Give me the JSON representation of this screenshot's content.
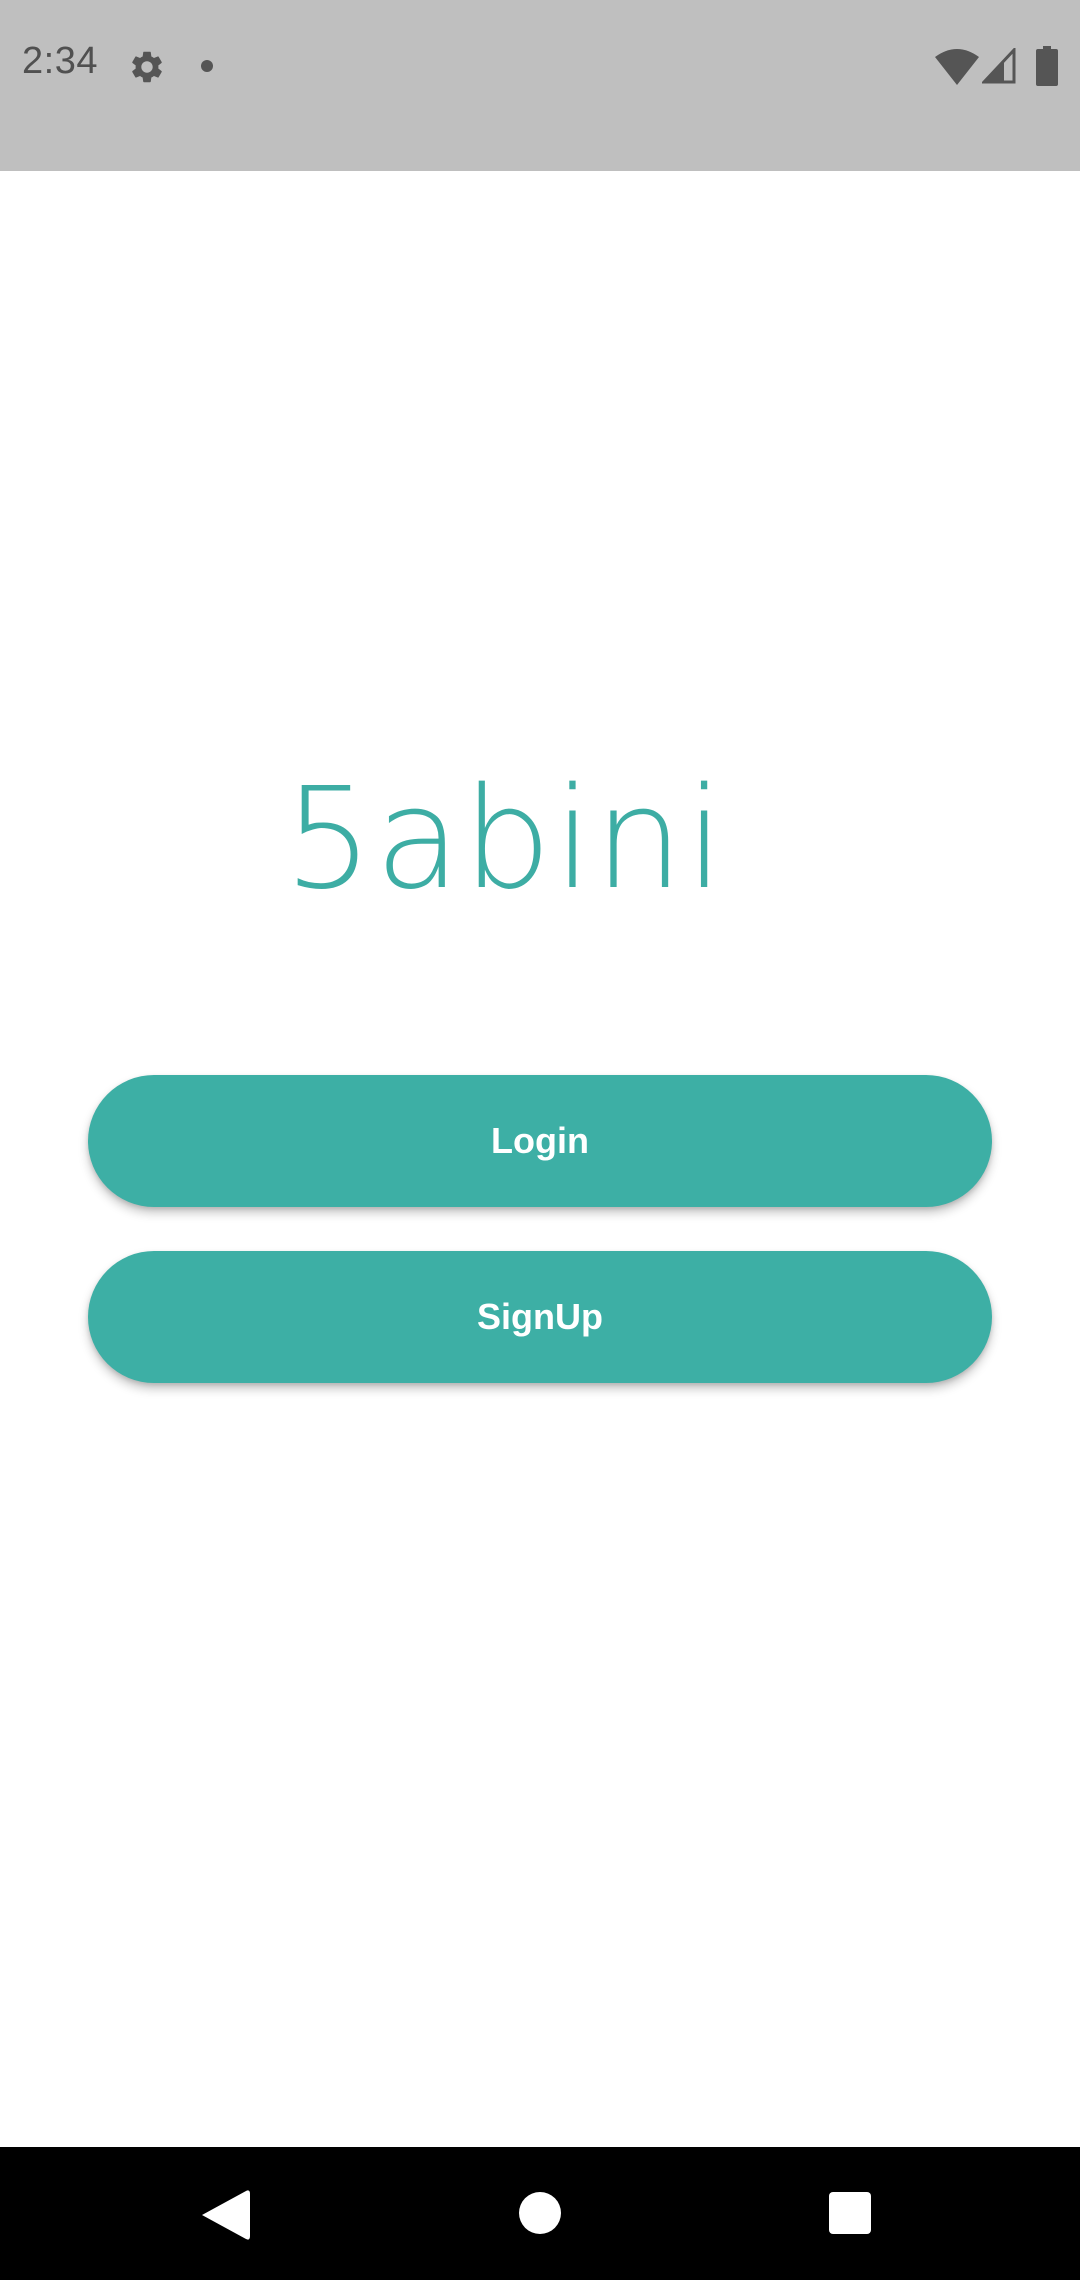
{
  "status_bar": {
    "time": "2:34",
    "icons": [
      "gear-icon",
      "notification-dot-icon",
      "wifi-icon",
      "signal-icon",
      "battery-icon"
    ]
  },
  "app": {
    "brand_name": "5abini",
    "accent_color": "#3dafa5"
  },
  "actions": {
    "login_label": "Login",
    "signup_label": "SignUp"
  },
  "nav_bar": {
    "icons": [
      "back-icon",
      "home-icon",
      "recent-apps-icon"
    ]
  }
}
